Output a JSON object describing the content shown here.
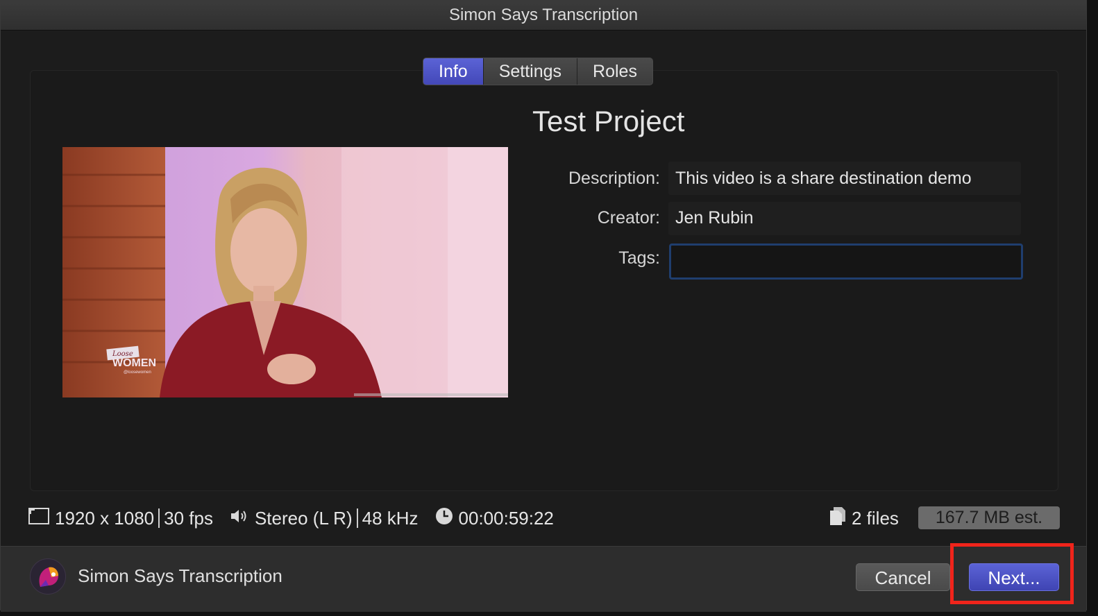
{
  "window": {
    "title": "Simon Says Transcription"
  },
  "tabs": [
    {
      "label": "Info",
      "active": true
    },
    {
      "label": "Settings",
      "active": false
    },
    {
      "label": "Roles",
      "active": false
    }
  ],
  "project": {
    "title": "Test Project",
    "thumbnail_logo_line1": "Loose",
    "thumbnail_logo_line2": "WOMEN",
    "thumbnail_logo_handle": "@loosewomen"
  },
  "fields": {
    "description": {
      "label": "Description:",
      "value": "This video is a share destination demo"
    },
    "creator": {
      "label": "Creator:",
      "value": "Jen Rubin"
    },
    "tags": {
      "label": "Tags:",
      "value": "",
      "placeholder": ""
    }
  },
  "info": {
    "resolution": "1920 x 1080",
    "fps": "30 fps",
    "audio": "Stereo (L R)",
    "sample_rate": "48 kHz",
    "duration": "00:00:59:22",
    "files": "2 files",
    "size": "167.7 MB est."
  },
  "footer": {
    "app_name": "Simon Says Transcription",
    "cancel_label": "Cancel",
    "next_label": "Next..."
  },
  "colors": {
    "accent": "#4a50c4",
    "highlight": "#f0241b",
    "focus_ring": "#1f3e6e"
  }
}
